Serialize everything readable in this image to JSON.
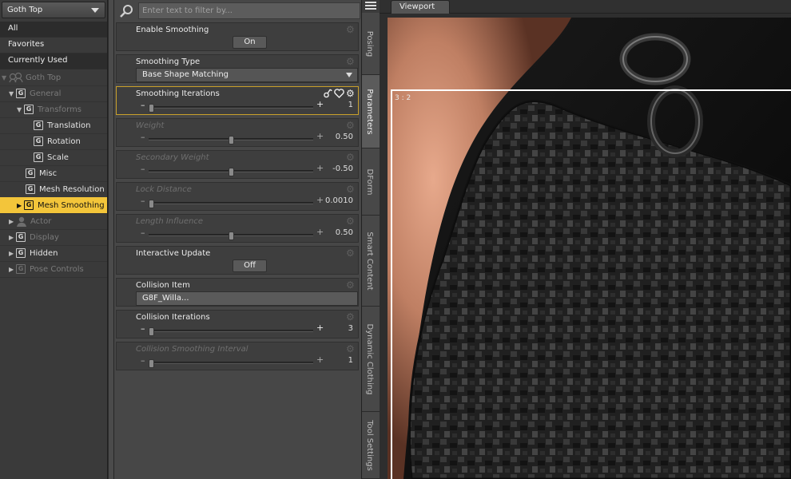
{
  "node_selector": {
    "value": "Goth Top"
  },
  "filters": [
    "All",
    "Favorites",
    "Currently Used"
  ],
  "tree": [
    {
      "label": "Goth Top",
      "dim": true
    },
    {
      "label": "General",
      "dim": true
    },
    {
      "label": "Transforms",
      "dim": true
    },
    {
      "label": "Translation",
      "dim": false
    },
    {
      "label": "Rotation",
      "dim": false
    },
    {
      "label": "Scale",
      "dim": false
    },
    {
      "label": "Misc",
      "dim": false
    },
    {
      "label": "Mesh Resolution",
      "dim": false
    },
    {
      "label": "Mesh Smoothing",
      "dim": false,
      "selected": true
    },
    {
      "label": "Actor",
      "dim": true
    },
    {
      "label": "Display",
      "dim": true
    },
    {
      "label": "Hidden",
      "dim": false
    },
    {
      "label": "Pose Controls",
      "dim": true
    }
  ],
  "search": {
    "placeholder": "Enter text to filter by..."
  },
  "params": [
    {
      "title": "Enable Smoothing",
      "kind": "button",
      "value": "On"
    },
    {
      "title": "Smoothing Type",
      "kind": "dropdown",
      "value": "Base Shape Matching"
    },
    {
      "title": "Smoothing Iterations",
      "kind": "slider",
      "value": "1",
      "level": 0.0,
      "active": true
    },
    {
      "title": "Weight",
      "kind": "slider",
      "value": "0.50",
      "level": 0.5,
      "dim": true
    },
    {
      "title": "Secondary Weight",
      "kind": "slider",
      "value": "-0.50",
      "level": 0.5,
      "dim": true
    },
    {
      "title": "Lock Distance",
      "kind": "slider",
      "value": "0.0010",
      "level": 0.0,
      "dim": true
    },
    {
      "title": "Length Influence",
      "kind": "slider",
      "value": "0.50",
      "level": 0.5,
      "dim": true
    },
    {
      "title": "Interactive Update",
      "kind": "button",
      "value": "Off"
    },
    {
      "title": "Collision Item",
      "kind": "dropdown",
      "value": "G8F_Willa..."
    },
    {
      "title": "Collision Iterations",
      "kind": "slider",
      "value": "3",
      "level": 0.0
    },
    {
      "title": "Collision Smoothing Interval",
      "kind": "slider",
      "value": "1",
      "level": 0.0,
      "dim": true
    }
  ],
  "side_tabs": [
    "Posing",
    "Parameters",
    "DForm",
    "Smart Content",
    "Dynamic Clothing",
    "Tool Settings"
  ],
  "viewport": {
    "tab": "Viewport",
    "aspect": "3 : 2"
  },
  "colors": {
    "selection": "#f3c53a",
    "active_border": "#c9a02a"
  },
  "icons": [
    "search-icon",
    "menu-icon",
    "figure-icon",
    "gear-icon",
    "lock-icon",
    "heart-icon"
  ]
}
